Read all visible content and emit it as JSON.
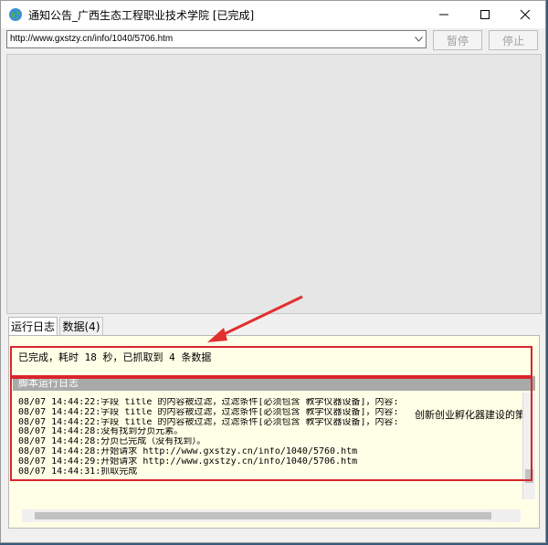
{
  "window": {
    "title": "通知公告_广西生态工程职业技术学院 [已完成]"
  },
  "address_bar": {
    "url": "http://www.gxstzy.cn/info/1040/5706.htm"
  },
  "toolbar": {
    "pause_label": "暂停",
    "stop_label": "停止"
  },
  "tabs": [
    {
      "label": "运行日志",
      "active": true
    },
    {
      "label": "数据(4)",
      "active": false
    }
  ],
  "panel": {
    "status": "已完成，耗时 18 秒，已抓取到 4 条数据",
    "section_header": "脚本运行日志",
    "log_lines": [
      "08/07 14:44:22:字段 title 的内容被过滤，过滤条件[必须包含 教学仪器设备]，内容:",
      "08/07 14:44:22:字段 title 的内容被过滤，过滤条件[必须包含 教学仪器设备]，内容:",
      "08/07 14:44:22:字段 title 的内容被过滤，过滤条件[必须包含 教学仪器设备]，内容:",
      "08/07 14:44:28:没有找到分页元素。",
      "08/07 14:44:28:分页已完成（没有找到）。",
      "08/07 14:44:28:开始请求 http://www.gxstzy.cn/info/1040/5760.htm",
      "08/07 14:44:29:开始请求 http://www.gxstzy.cn/info/1040/5706.htm",
      "08/07 14:44:31:抓取完成"
    ],
    "overflow_text": "创新创业孵化器建设的策"
  },
  "colors": {
    "highlight_box": "#d8252b",
    "arrow": "#e0302f",
    "panel_bg": "#ffffe7"
  }
}
